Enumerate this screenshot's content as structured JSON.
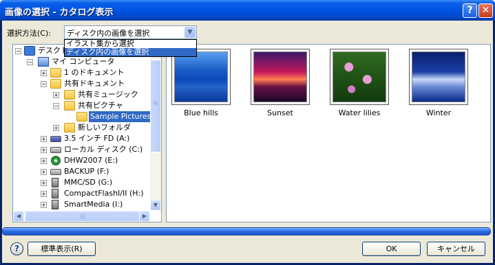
{
  "window": {
    "title": "画像の選択 - カタログ表示",
    "help_glyph": "?",
    "close_glyph": "✕"
  },
  "method": {
    "label": "選択方法(C):",
    "selected": "ディスク内の画像を選択",
    "options": [
      "イラスト集から選択",
      "ディスク内の画像を選択"
    ]
  },
  "tree": {
    "items": [
      {
        "label": "デスクトップ",
        "icon": "desktop-icon",
        "expander": "−"
      },
      {
        "label": "マイ コンピュータ",
        "icon": "my-computer-icon",
        "expander": "−"
      },
      {
        "label": "1 のドキュメント",
        "icon": "folder-icon",
        "expander": "+"
      },
      {
        "label": "共有ドキュメント",
        "icon": "folder-icon",
        "expander": "−"
      },
      {
        "label": "共有ミュージック",
        "icon": "music-folder-icon",
        "expander": "+"
      },
      {
        "label": "共有ピクチャ",
        "icon": "pictures-folder-icon",
        "expander": "−"
      },
      {
        "label": "Sample Pictures",
        "icon": "folder-icon",
        "expander": ""
      },
      {
        "label": "新しいフォルダ",
        "icon": "folder-icon",
        "expander": "+"
      },
      {
        "label": "3.5 インチ FD (A:)",
        "icon": "floppy-icon",
        "expander": "+"
      },
      {
        "label": "ローカル ディスク (C:)",
        "icon": "hard-drive-icon",
        "expander": "+"
      },
      {
        "label": "DHW2007 (E:)",
        "icon": "cd-drive-icon",
        "expander": "+"
      },
      {
        "label": "BACKUP (F:)",
        "icon": "hard-drive-icon",
        "expander": "+"
      },
      {
        "label": "MMC/SD (G:)",
        "icon": "card-drive-icon",
        "expander": "+"
      },
      {
        "label": "CompactFlashI/II (H:)",
        "icon": "card-drive-icon",
        "expander": "+"
      },
      {
        "label": "SmartMedia (I:)",
        "icon": "card-drive-icon",
        "expander": "+"
      }
    ],
    "selected_index": 6,
    "scroll_grip": "≡",
    "hscroll_grip": "|||"
  },
  "thumbnails": [
    {
      "label": "Blue hills"
    },
    {
      "label": "Sunset"
    },
    {
      "label": "Water lilies"
    },
    {
      "label": "Winter"
    }
  ],
  "footer": {
    "help_glyph": "?",
    "standard_view_label": "標準表示(R)",
    "ok_label": "OK",
    "cancel_label": "キャンセル"
  },
  "colors": {
    "title_bar": "#0054e3",
    "selection": "#316ac5",
    "dialog_bg": "#ece9d8"
  }
}
